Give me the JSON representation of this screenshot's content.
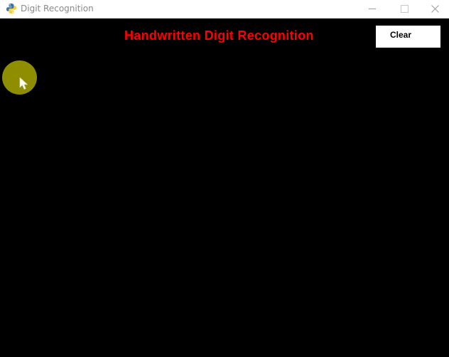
{
  "window": {
    "title": "Digit Recognition",
    "app_icon": "python-pygame-icon",
    "controls": {
      "minimize_icon": "minimize-icon",
      "maximize_icon": "maximize-icon",
      "close_icon": "close-icon"
    }
  },
  "canvas": {
    "heading": "Handwritten Digit Recognition",
    "heading_color": "#ff0000",
    "background_color": "#000000",
    "clear_button_label": "Clear",
    "cursor_highlight_color": "#9a9a00"
  }
}
